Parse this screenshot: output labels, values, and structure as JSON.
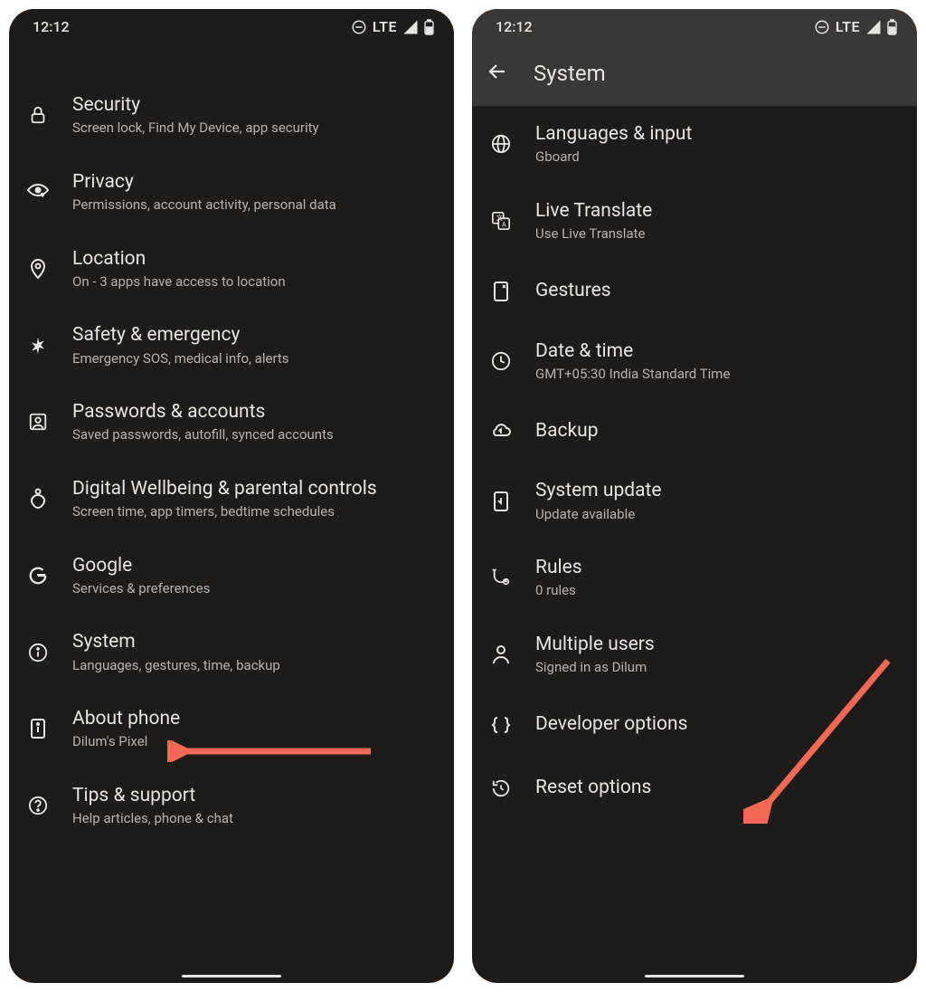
{
  "colors": {
    "arrow": "#f26a57"
  },
  "status": {
    "time": "12:12",
    "network": "LTE"
  },
  "left": {
    "items": [
      {
        "title": "Security",
        "sub": "Screen lock, Find My Device, app security"
      },
      {
        "title": "Privacy",
        "sub": "Permissions, account activity, personal data"
      },
      {
        "title": "Location",
        "sub": "On - 3 apps have access to location"
      },
      {
        "title": "Safety & emergency",
        "sub": "Emergency SOS, medical info, alerts"
      },
      {
        "title": "Passwords & accounts",
        "sub": "Saved passwords, autofill, synced accounts"
      },
      {
        "title": "Digital Wellbeing & parental controls",
        "sub": "Screen time, app timers, bedtime schedules"
      },
      {
        "title": "Google",
        "sub": "Services & preferences"
      },
      {
        "title": "System",
        "sub": "Languages, gestures, time, backup"
      },
      {
        "title": "About phone",
        "sub": "Dilum's Pixel"
      },
      {
        "title": "Tips & support",
        "sub": "Help articles, phone & chat"
      }
    ]
  },
  "right": {
    "header": "System",
    "items": [
      {
        "title": "Languages & input",
        "sub": "Gboard"
      },
      {
        "title": "Live Translate",
        "sub": "Use Live Translate"
      },
      {
        "title": "Gestures",
        "sub": ""
      },
      {
        "title": "Date & time",
        "sub": "GMT+05:30 India Standard Time"
      },
      {
        "title": "Backup",
        "sub": ""
      },
      {
        "title": "System update",
        "sub": "Update available"
      },
      {
        "title": "Rules",
        "sub": "0 rules"
      },
      {
        "title": "Multiple users",
        "sub": "Signed in as Dilum"
      },
      {
        "title": "Developer options",
        "sub": ""
      },
      {
        "title": "Reset options",
        "sub": ""
      }
    ]
  }
}
